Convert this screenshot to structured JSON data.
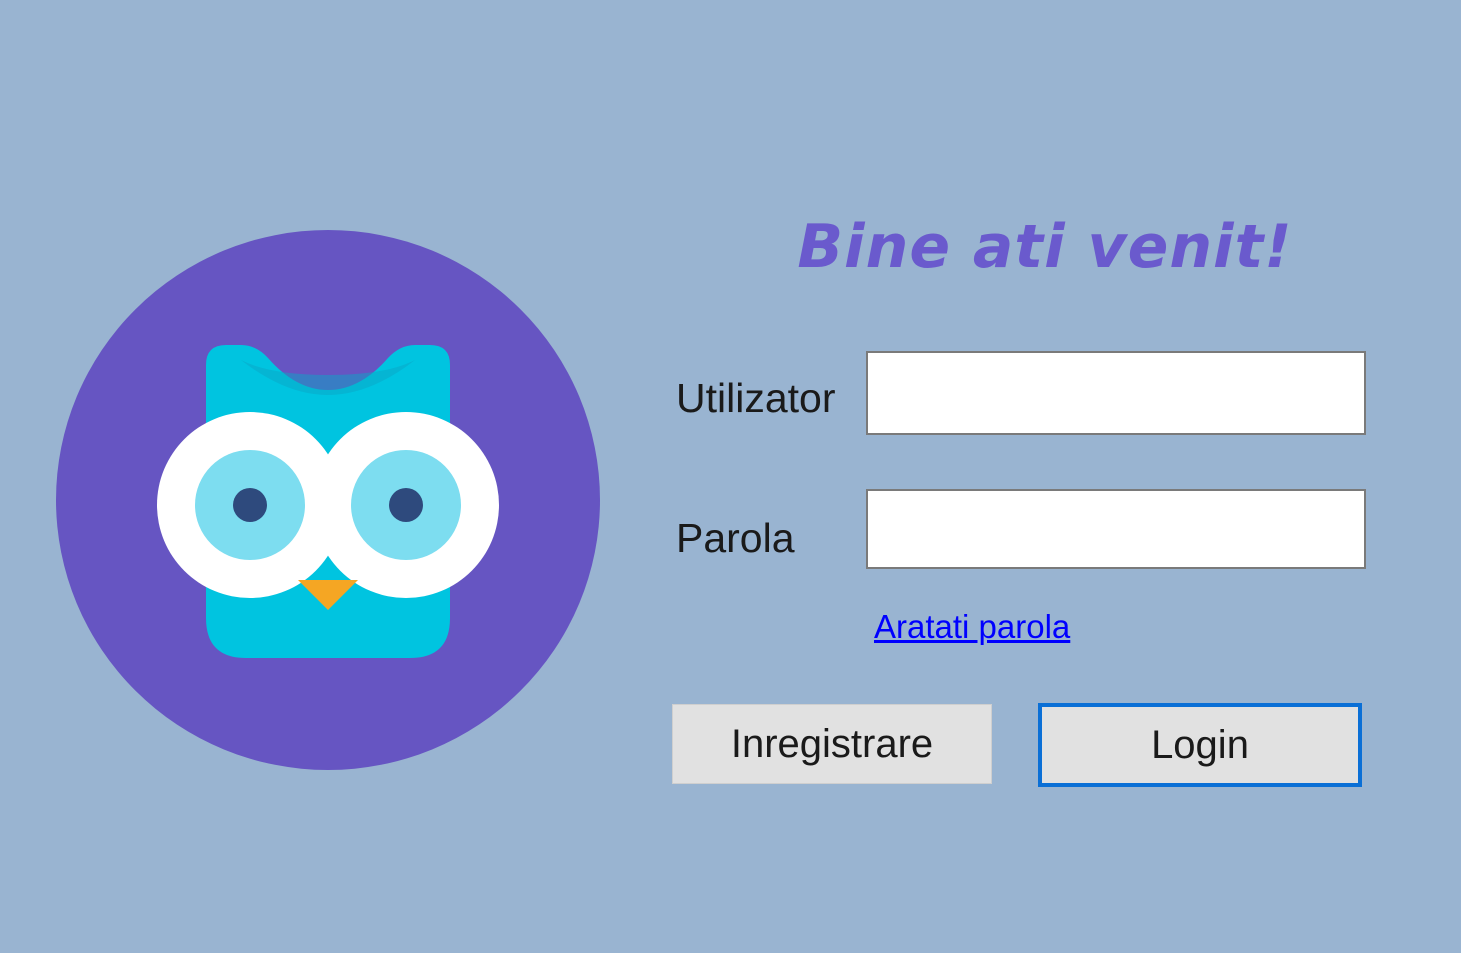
{
  "form": {
    "title": "Bine ati venit!",
    "username_label": "Utilizator",
    "username_value": "",
    "password_label": "Parola",
    "password_value": "",
    "show_password_link": "Aratati parola",
    "register_button": "Inregistrare",
    "login_button": "Login"
  },
  "logo": {
    "icon": "owl-logo-icon",
    "colors": {
      "circle": "#6655c2",
      "body": "#00c4e0",
      "eye_white": "#ffffff",
      "iris": "#7dddf0",
      "pupil": "#2e4a7d",
      "beak": "#f5a623"
    }
  },
  "colors": {
    "background": "#99b4d1",
    "title": "#6a5acd",
    "link": "#0000ff",
    "focus_border": "#0a6fd6"
  }
}
